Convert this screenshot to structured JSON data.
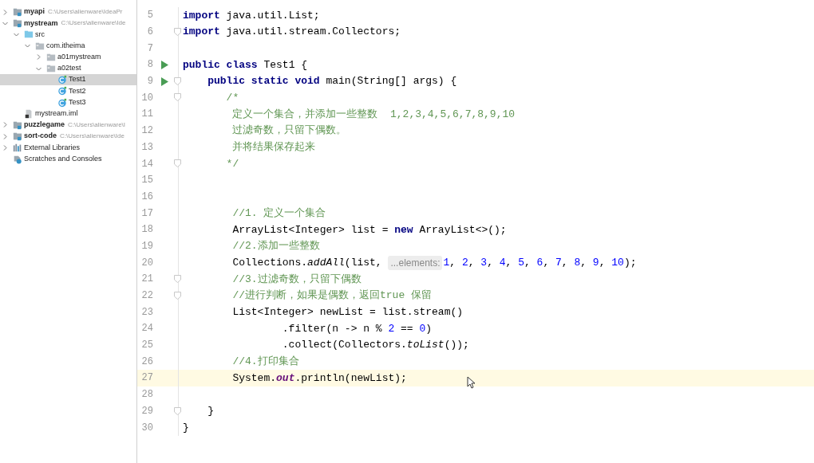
{
  "project_tree": [
    {
      "label": "myapi",
      "kind": "module",
      "path": "C:\\Users\\alienware\\IdeaPr",
      "expanded": false,
      "selected": false
    },
    {
      "label": "mystream",
      "kind": "module",
      "path": "C:\\Users\\alienware\\Ide",
      "expanded": true,
      "selected": false,
      "children": [
        {
          "label": "src",
          "kind": "source",
          "expanded": true,
          "selected": false,
          "children": [
            {
              "label": "com.itheima",
              "kind": "package",
              "expanded": true,
              "selected": false,
              "children": [
                {
                  "label": "a01mystream",
                  "kind": "package",
                  "expanded": false,
                  "selected": false
                },
                {
                  "label": "a02test",
                  "kind": "package",
                  "expanded": true,
                  "selected": false,
                  "children": [
                    {
                      "label": "Test1",
                      "kind": "class",
                      "selected": true
                    },
                    {
                      "label": "Test2",
                      "kind": "class",
                      "selected": false
                    },
                    {
                      "label": "Test3",
                      "kind": "class",
                      "selected": false
                    }
                  ]
                }
              ]
            }
          ]
        },
        {
          "label": "mystream.iml",
          "kind": "iml",
          "selected": false
        }
      ]
    },
    {
      "label": "puzzlegame",
      "kind": "module",
      "path": "C:\\Users\\alienware\\I",
      "expanded": false,
      "selected": false
    },
    {
      "label": "sort-code",
      "kind": "module",
      "path": "C:\\Users\\alienware\\Ide",
      "expanded": false,
      "selected": false
    },
    {
      "label": "External Libraries",
      "kind": "libraries",
      "expanded": false,
      "selected": false
    },
    {
      "label": "Scratches and Consoles",
      "kind": "scratches",
      "selected": false
    }
  ],
  "editor": {
    "lines": [
      {
        "number": "5",
        "run": false,
        "fold": false,
        "current": false,
        "tokens": [
          {
            "kind": "keyword",
            "text": "import"
          },
          {
            "kind": "plain",
            "text": " java.util.List;"
          }
        ]
      },
      {
        "number": "6",
        "run": false,
        "fold": true,
        "current": false,
        "tokens": [
          {
            "kind": "keyword",
            "text": "import"
          },
          {
            "kind": "plain",
            "text": " java.util.stream.Collectors;"
          }
        ]
      },
      {
        "number": "7",
        "run": false,
        "fold": false,
        "current": false
      },
      {
        "number": "8",
        "run": true,
        "fold": false,
        "current": false,
        "tokens": [
          {
            "kind": "keyword",
            "text": "public class"
          },
          {
            "kind": "plain",
            "text": " Test1 {"
          }
        ]
      },
      {
        "number": "9",
        "run": true,
        "fold": true,
        "current": false,
        "tokens": [
          {
            "kind": "keyword",
            "text": "    public static void"
          },
          {
            "kind": "plain",
            "text": " main(String[] args) {"
          }
        ]
      },
      {
        "number": "10",
        "run": false,
        "fold": true,
        "current": false,
        "tokens": [
          {
            "kind": "comment",
            "text": "       /*"
          }
        ]
      },
      {
        "number": "11",
        "run": false,
        "fold": false,
        "current": false,
        "tokens": [
          {
            "kind": "comment",
            "text": "        定义一个集合，并添加一些整数  1,2,3,4,5,6,7,8,9,10"
          }
        ]
      },
      {
        "number": "12",
        "run": false,
        "fold": false,
        "current": false,
        "tokens": [
          {
            "kind": "comment",
            "text": "        过滤奇数，只留下偶数。"
          }
        ]
      },
      {
        "number": "13",
        "run": false,
        "fold": false,
        "current": false,
        "tokens": [
          {
            "kind": "comment",
            "text": "        并将结果保存起来"
          }
        ]
      },
      {
        "number": "14",
        "run": false,
        "fold": true,
        "current": false,
        "tokens": [
          {
            "kind": "comment",
            "text": "       */"
          }
        ]
      },
      {
        "number": "15",
        "run": false,
        "fold": false,
        "current": false
      },
      {
        "number": "16",
        "run": false,
        "fold": false,
        "current": false
      },
      {
        "number": "17",
        "run": false,
        "fold": false,
        "current": false,
        "tokens": [
          {
            "kind": "comment",
            "text": "        //1. 定义一个集合"
          }
        ]
      },
      {
        "number": "18",
        "run": false,
        "fold": false,
        "current": false,
        "tokens": [
          {
            "kind": "plain",
            "text": "        ArrayList<Integer> list = "
          },
          {
            "kind": "keyword",
            "text": "new"
          },
          {
            "kind": "plain",
            "text": " ArrayList<>();"
          }
        ]
      },
      {
        "number": "19",
        "run": false,
        "fold": false,
        "current": false,
        "tokens": [
          {
            "kind": "comment",
            "text": "        //2.添加一些整数"
          }
        ]
      },
      {
        "number": "20",
        "run": false,
        "fold": false,
        "current": false,
        "tokens": [
          {
            "kind": "plain",
            "text": "        Collections."
          },
          {
            "kind": "italic",
            "text": "addAll"
          },
          {
            "kind": "plain",
            "text": "(list, "
          },
          {
            "kind": "hint",
            "text": "...elements:"
          },
          {
            "kind": "number",
            "text": "1"
          },
          {
            "kind": "plain",
            "text": ", "
          },
          {
            "kind": "number",
            "text": "2"
          },
          {
            "kind": "plain",
            "text": ", "
          },
          {
            "kind": "number",
            "text": "3"
          },
          {
            "kind": "plain",
            "text": ", "
          },
          {
            "kind": "number",
            "text": "4"
          },
          {
            "kind": "plain",
            "text": ", "
          },
          {
            "kind": "number",
            "text": "5"
          },
          {
            "kind": "plain",
            "text": ", "
          },
          {
            "kind": "number",
            "text": "6"
          },
          {
            "kind": "plain",
            "text": ", "
          },
          {
            "kind": "number",
            "text": "7"
          },
          {
            "kind": "plain",
            "text": ", "
          },
          {
            "kind": "number",
            "text": "8"
          },
          {
            "kind": "plain",
            "text": ", "
          },
          {
            "kind": "number",
            "text": "9"
          },
          {
            "kind": "plain",
            "text": ", "
          },
          {
            "kind": "number",
            "text": "10"
          },
          {
            "kind": "plain",
            "text": ");"
          }
        ]
      },
      {
        "number": "21",
        "run": false,
        "fold": true,
        "current": false,
        "tokens": [
          {
            "kind": "comment",
            "text": "        //3.过滤奇数，只留下偶数"
          }
        ]
      },
      {
        "number": "22",
        "run": false,
        "fold": true,
        "current": false,
        "tokens": [
          {
            "kind": "comment",
            "text": "        //进行判断，如果是偶数，返回true 保留"
          }
        ]
      },
      {
        "number": "23",
        "run": false,
        "fold": false,
        "current": false,
        "tokens": [
          {
            "kind": "plain",
            "text": "        List<Integer> newList = list.stream()"
          }
        ]
      },
      {
        "number": "24",
        "run": false,
        "fold": false,
        "current": false,
        "tokens": [
          {
            "kind": "plain",
            "text": "                .filter(n -> n % "
          },
          {
            "kind": "number",
            "text": "2"
          },
          {
            "kind": "plain",
            "text": " == "
          },
          {
            "kind": "number",
            "text": "0"
          },
          {
            "kind": "plain",
            "text": ")"
          }
        ]
      },
      {
        "number": "25",
        "run": false,
        "fold": false,
        "current": false,
        "tokens": [
          {
            "kind": "plain",
            "text": "                .collect(Collectors."
          },
          {
            "kind": "italic",
            "text": "toList"
          },
          {
            "kind": "plain",
            "text": "());"
          }
        ]
      },
      {
        "number": "26",
        "run": false,
        "fold": false,
        "current": false,
        "tokens": [
          {
            "kind": "comment",
            "text": "        //4.打印集合"
          }
        ]
      },
      {
        "number": "27",
        "run": false,
        "fold": false,
        "current": true,
        "tokens": [
          {
            "kind": "plain",
            "text": "        System."
          },
          {
            "kind": "static",
            "text": "out"
          },
          {
            "kind": "plain",
            "text": ".println(newList);"
          }
        ]
      },
      {
        "number": "28",
        "run": false,
        "fold": false,
        "current": false
      },
      {
        "number": "29",
        "run": false,
        "fold": true,
        "current": false,
        "tokens": [
          {
            "kind": "plain",
            "text": "    }"
          }
        ]
      },
      {
        "number": "30",
        "run": false,
        "fold": false,
        "current": false,
        "tokens": [
          {
            "kind": "plain",
            "text": "}"
          }
        ]
      }
    ]
  }
}
